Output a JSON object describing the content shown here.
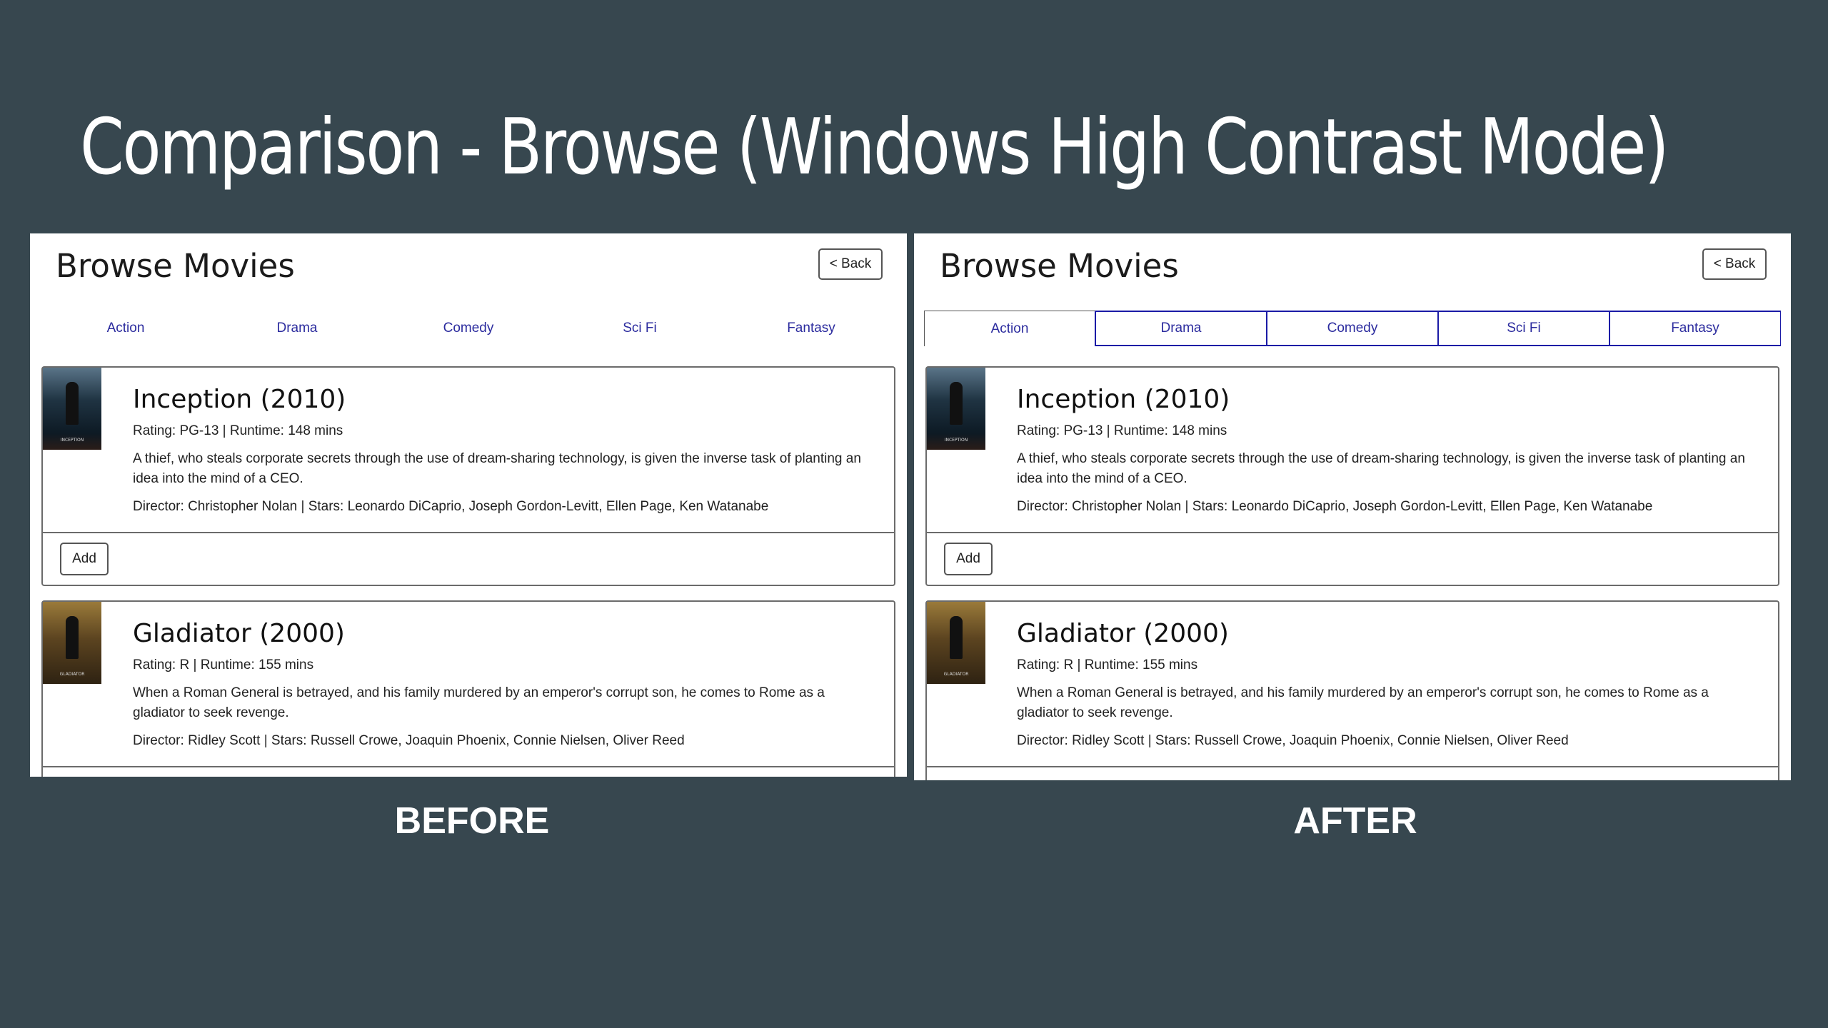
{
  "slide": {
    "title": "Comparison - Browse (Windows High Contrast Mode)",
    "captions": {
      "before": "BEFORE",
      "after": "AFTER"
    }
  },
  "app": {
    "heading": "Browse Movies",
    "back_label": "< Back",
    "tabs": [
      "Action",
      "Drama",
      "Comedy",
      "Sci Fi",
      "Fantasy"
    ],
    "add_label": "Add",
    "movies": [
      {
        "title": "Inception (2010)",
        "meta": "Rating: PG-13 | Runtime: 148 mins",
        "description": "A thief, who steals corporate secrets through the use of dream-sharing technology, is given the inverse task of planting an idea into the mind of a CEO.",
        "credits": "Director: Christopher Nolan | Stars: Leonardo DiCaprio, Joseph Gordon-Levitt, Ellen Page, Ken Watanabe",
        "poster_text": "INCEPTION"
      },
      {
        "title": "Gladiator (2000)",
        "meta": "Rating: R | Runtime: 155 mins",
        "description": "When a Roman General is betrayed, and his family murdered by an emperor's corrupt son, he comes to Rome as a gladiator to seek revenge.",
        "credits": "Director: Ridley Scott | Stars: Russell Crowe, Joaquin Phoenix, Connie Nielsen, Oliver Reed",
        "poster_text": "GLADIATOR"
      }
    ]
  },
  "colors": {
    "background": "#37474f",
    "tab_text": "#2b2b9e",
    "tab_border_high_contrast": "#1a1aa6"
  }
}
